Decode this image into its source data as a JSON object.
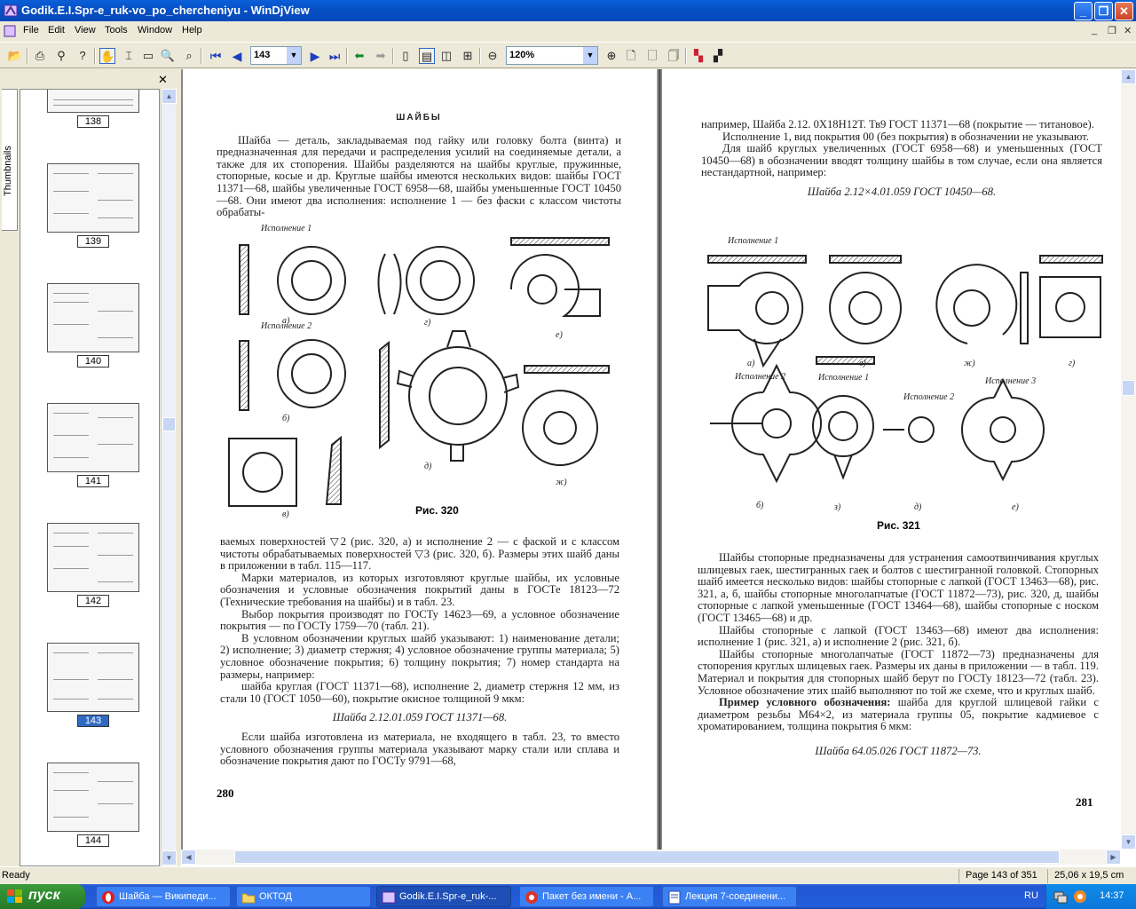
{
  "window": {
    "title": "Godik.E.I.Spr-e_ruk-vo_po_chercheniyu - WinDjView"
  },
  "menu": [
    "File",
    "Edit",
    "View",
    "Tools",
    "Window",
    "Help"
  ],
  "toolbar": {
    "page_value": "143",
    "zoom_value": "120%"
  },
  "thumbnails": {
    "tab_label": "Thumbnails",
    "pages": [
      "138",
      "139",
      "140",
      "141",
      "142",
      "143",
      "144"
    ],
    "selected": "143"
  },
  "left_page": {
    "heading": "ШАЙБЫ",
    "para1": "Шайба — деталь, закладываемая под гайку или головку болта (винта) и предназначенная для передачи и распределения усилий на соединяемые детали, а также для их стопорения. Шайбы разделяются на шайбы круглые, пружинные, стопорные, косые и др. Круглые шайбы имеются нескольких видов: шайбы ГОСТ 11371—68, шайбы увеличенные ГОСТ 6958—68, шайбы уменьшенные ГОСТ 10450—68. Они имеют два исполнения: исполнение 1 — без фаски с классом чистоты обрабаты-",
    "fig_caption": "Рис. 320",
    "fig_labels": [
      "Исполнение 1",
      "Исполнение 2",
      "а)",
      "б)",
      "в)",
      "г)",
      "д)",
      "е)",
      "ж)"
    ],
    "para2": "ваемых поверхностей ▽2 (рис. 320, а) и исполнение 2 — с фаской и с классом чистоты обрабатываемых поверхностей ▽3 (рис. 320, б). Размеры этих шайб даны в приложении в табл. 115—117.",
    "para3": "Марки материалов, из которых изготовляют круглые шайбы, их условные обозначения и условные обозначения покрытий даны в ГОСТе 18123—72 (Технические требования на шайбы) и в табл. 23.",
    "para4": "Выбор покрытия производят по ГОСТу 14623—69, а условное обозначение покрытия — по ГОСТу 1759—70 (табл. 21).",
    "para5": "В условном обозначении круглых шайб указывают: 1) наименование детали; 2) исполнение; 3) диаметр стержня; 4) условное обозначение группы материала; 5) условное обозначение покрытия; 6) толщину покрытия; 7) номер стандарта на размеры, например:",
    "para6": "шайба круглая (ГОСТ 11371—68), исполнение 2, диаметр стержня 12 мм, из стали 10 (ГОСТ 1050—60), покрытие окисное толщиной 9 мкм:",
    "formula": "Шайба 2.12.01.059 ГОСТ 11371—68.",
    "para7": "Если шайба изготовлена из материала, не входящего в табл. 23, то вместо условного обозначения группы материала указывают марку стали или сплава и обозначение покрытия дают по ГОСТу 9791—68,",
    "page_number": "280"
  },
  "right_page": {
    "para1": "например, Шайба 2.12. 0Х18Н12Т. Тв9 ГОСТ 11371—68 (покрытие — титановое).",
    "para2": "Исполнение 1, вид покрытия 00 (без покрытия) в обозначении не указывают.",
    "para3": "Для шайб круглых увеличенных (ГОСТ 6958—68) и уменьшенных (ГОСТ 10450—68) в обозначении вводят толщину шайбы в том случае, если она является нестандартной, например:",
    "formula1": "Шайба 2.12×4.01.059 ГОСТ 10450—68.",
    "fig_caption": "Рис. 321",
    "fig_labels": [
      "Исполнение 1",
      "Исполнение 2",
      "Исполнение 1",
      "Исполнение 2",
      "Исполнение 3",
      "а)",
      "б)",
      "в)",
      "г)",
      "д)",
      "е)",
      "ж)",
      "з)"
    ],
    "para4": "Шайбы стопорные предназначены для устранения самоотвинчивания круглых шлицевых гаек, шестигранных гаек и болтов с шестигранной головкой. Стопорных шайб имеется несколько видов: шайбы стопорные с лапкой (ГОСТ 13463—68), рис. 321, а, б, шайбы стопорные многолапчатые (ГОСТ 11872—73), рис. 320, д, шайбы стопорные с лапкой уменьшенные (ГОСТ 13464—68), шайбы стопорные с носком (ГОСТ 13465—68) и др.",
    "para5": "Шайбы стопорные с лапкой (ГОСТ 13463—68) имеют два исполнения: исполнение 1 (рис. 321, а) и исполнение 2 (рис. 321, б).",
    "para6": "Шайбы стопорные многолапчатые (ГОСТ 11872—73) предназначены для стопорения круглых шлицевых гаек. Размеры их даны в приложении — в табл. 119. Материал и покрытия для стопорных шайб берут по ГОСТу 18123—72 (табл. 23). Условное обозначение этих шайб выполняют по той же схеме, что и круглых шайб.",
    "para7_bold": "Пример условного обозначения:",
    "para7": " шайба для круглой шлицевой гайки с диаметром резьбы М64×2, из материала группы 05, покрытие кадмиевое с хроматированием, толщина покрытия 6 мкм:",
    "formula2": "Шайба 64.05.026 ГОСТ 11872—73.",
    "page_number": "281"
  },
  "status": {
    "ready": "Ready",
    "page_info": "Page 143 of 351",
    "size": "25,06 x 19,5 cm"
  },
  "taskbar": {
    "start": "пуск",
    "tasks": [
      "Шайба — Википеди...",
      "ОКТОД",
      "Godik.E.I.Spr-e_ruk-...",
      "Пакет без имени - A...",
      "Лекция 7-соединени..."
    ],
    "lang": "RU",
    "clock": "14:37"
  }
}
